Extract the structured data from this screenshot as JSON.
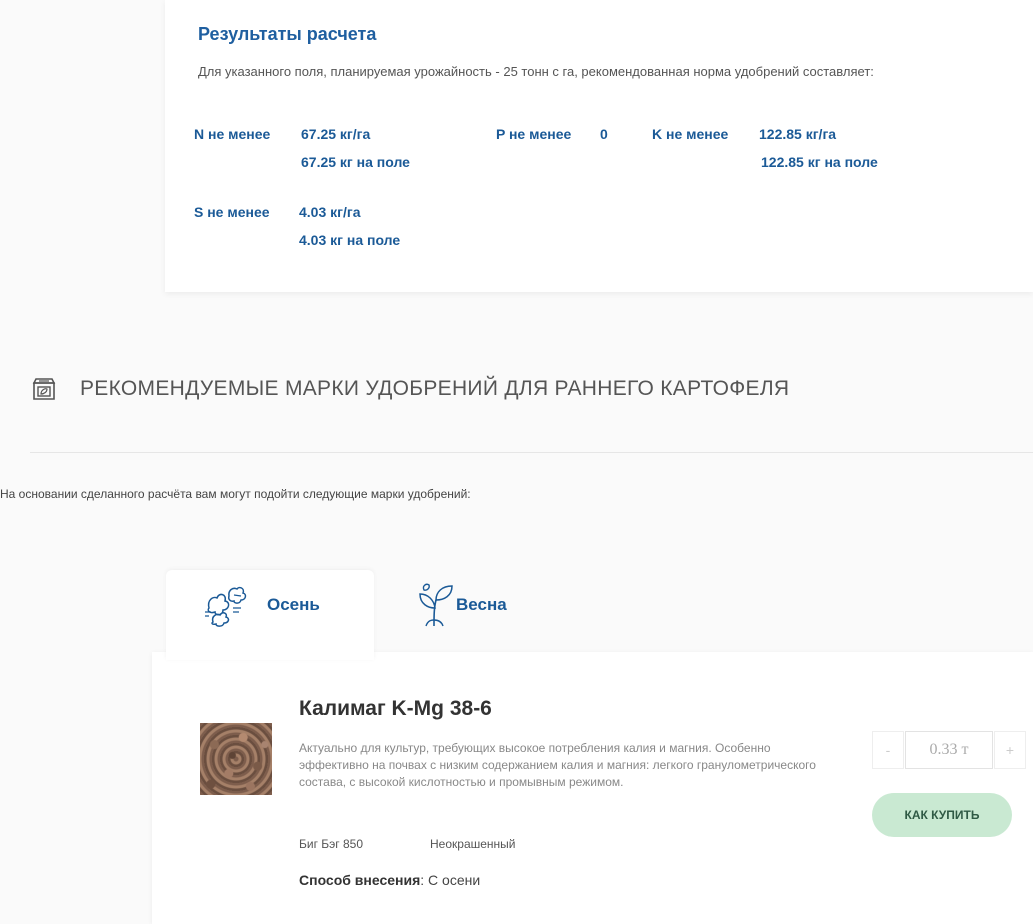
{
  "results": {
    "title": "Результаты расчета",
    "description": "Для указанного поля, планируемая урожайность - 25 тонн с га, рекомендованная норма удобрений составляет:",
    "nutrients": [
      {
        "label": "N не менее",
        "per_ha": "67.25 кг/га",
        "per_field": "67.25 кг на поле"
      },
      {
        "label": "P не менее",
        "per_ha": "0",
        "per_field": ""
      },
      {
        "label": "K не менее",
        "per_ha": "122.85 кг/га",
        "per_field": "122.85 кг на поле"
      },
      {
        "label": "S не менее",
        "per_ha": "4.03 кг/га",
        "per_field": "4.03 кг на поле"
      }
    ]
  },
  "section": {
    "icon": "fertilizer-bag-icon",
    "title": "РЕКОМЕНДУЕМЫЕ МАРКИ УДОБРЕНИЙ ДЛЯ РАННЕГО КАРТОФЕЛЯ",
    "intro": "На основании сделанного расчёта вам могут подойти следующие марки удобрений:"
  },
  "tabs": [
    {
      "label": "Осень",
      "icon": "autumn-leaves-icon",
      "active": true
    },
    {
      "label": "Весна",
      "icon": "sprout-icon",
      "active": false
    }
  ],
  "product": {
    "title": "Калимаг K-Mg 38-6",
    "description": "Актуально для культур, требующих высокое потребления калия и магния. Особенно эффективно на почвах с низким содержанием калия и магния: легкого гранулометрического состава, с высокой кислотностью и промывным режимом.",
    "packaging": "Биг Бэг 850",
    "color": "Неокрашенный",
    "method_label": "Способ внесения",
    "method_value": ": С осени",
    "quantity": "0.33 т",
    "minus": "-",
    "plus": "+",
    "buy_label": "КАК КУПИТЬ"
  }
}
